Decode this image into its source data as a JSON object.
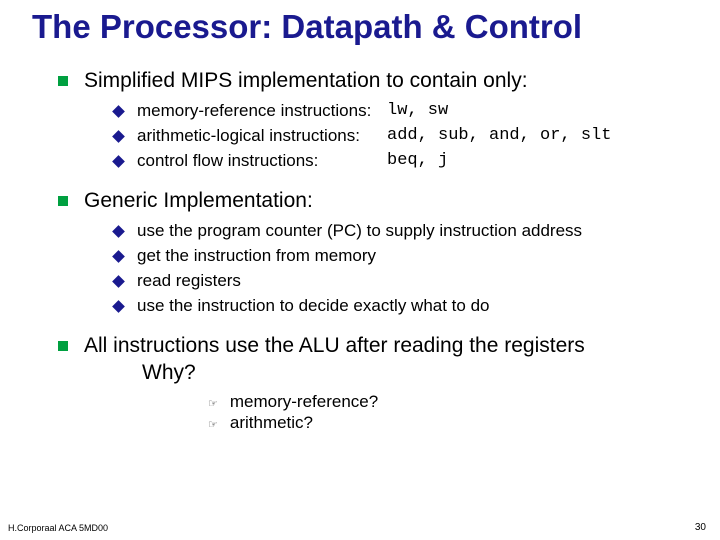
{
  "title": "The Processor:  Datapath & Control",
  "sections": [
    {
      "text": "Simplified MIPS implementation to contain only:",
      "items": [
        {
          "label": "memory-reference instructions:",
          "code": "lw, sw"
        },
        {
          "label": "arithmetic-logical instructions:",
          "code": "add, sub, and, or, slt"
        },
        {
          "label": "control flow instructions:",
          "code": "beq, j"
        }
      ]
    },
    {
      "text": "Generic Implementation:",
      "items": [
        {
          "label": "use the program counter (PC) to supply instruction address"
        },
        {
          "label": "get the instruction from memory"
        },
        {
          "label": "read registers"
        },
        {
          "label": "use the instruction to decide exactly what to do"
        }
      ]
    },
    {
      "text": "All instructions use the ALU after reading the registers",
      "why": "Why?",
      "subitems": [
        "memory-reference?",
        "arithmetic?"
      ]
    }
  ],
  "footer": {
    "left": "H.Corporaal  ACA 5MD00",
    "right": "30"
  }
}
